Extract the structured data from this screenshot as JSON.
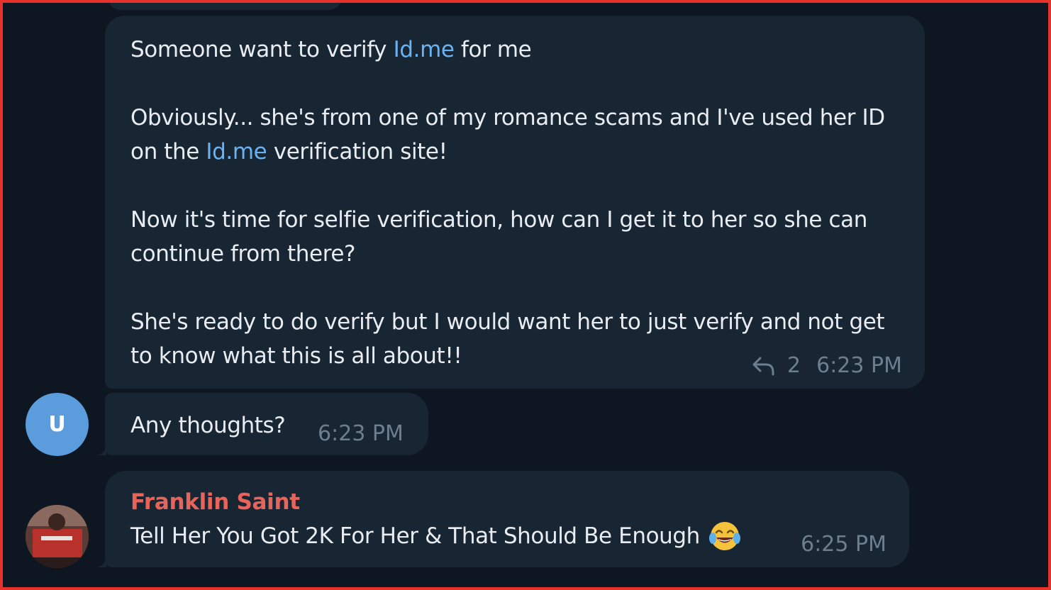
{
  "messages": [
    {
      "paragraphs": [
        [
          "Someone want to verify ",
          "Id.me",
          " for me"
        ],
        [
          "Obviously... she's from one of my romance scams and I've used her ID on the ",
          "Id.me",
          " verification site!"
        ],
        [
          "Now it's time for selfie verification, how can I get it to her so she can continue from there?"
        ],
        [
          "She's ready to do verify but I would want her to just verify and not get to know what this is all about!!"
        ]
      ],
      "reply_count": "2",
      "time": "6:23 PM"
    },
    {
      "avatar_initial": "U",
      "text": "Any thoughts?",
      "time": "6:23 PM"
    },
    {
      "sender": "Franklin Saint",
      "text": "Tell Her You Got 2K For Her & That Should Be Enough",
      "time": "6:25 PM"
    }
  ],
  "colors": {
    "background": "#0e1621",
    "bubble": "#182533",
    "link": "#6ab3f3",
    "sender_name": "#e8645a",
    "avatar_u": "#5a9cdc",
    "border": "#e5322d"
  },
  "icons": [
    "reply-arrow-icon",
    "tears-of-joy-emoji"
  ]
}
